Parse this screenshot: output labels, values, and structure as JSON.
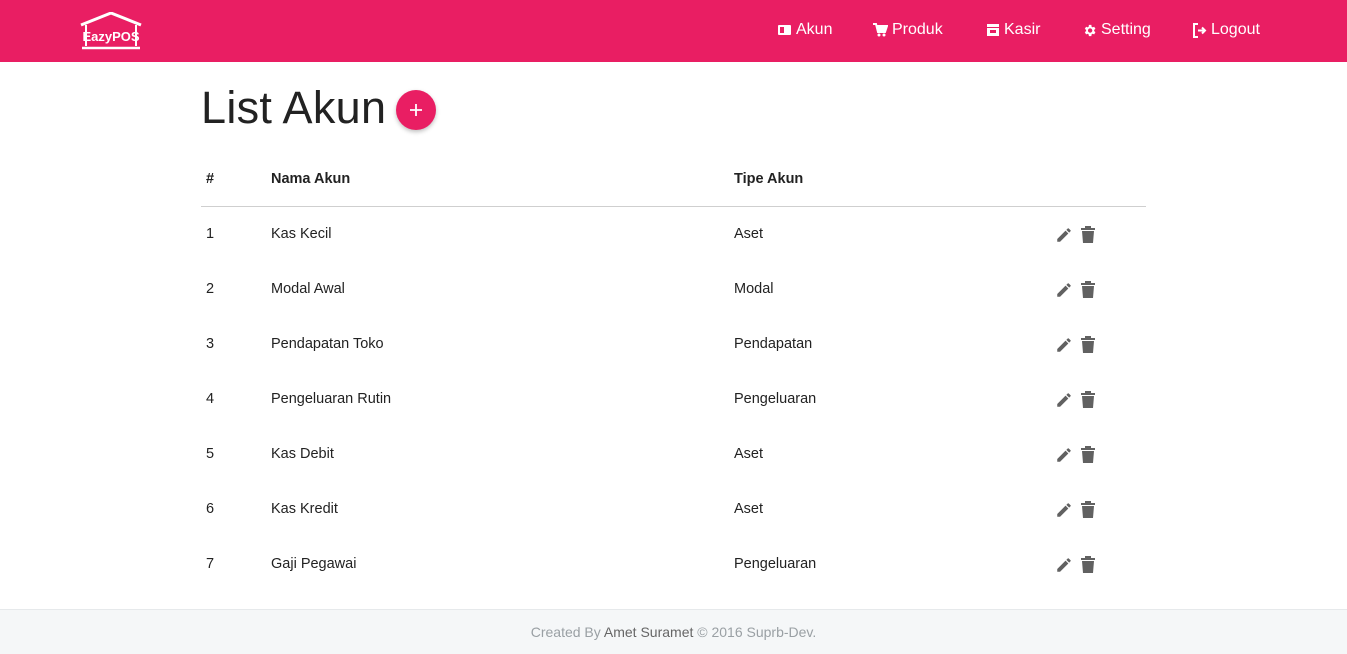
{
  "brand": {
    "logo_text": "EazyPOS",
    "color": "#e91e63"
  },
  "nav": {
    "items": [
      {
        "label": "Akun",
        "icon": "account-icon"
      },
      {
        "label": "Produk",
        "icon": "cart-icon"
      },
      {
        "label": "Kasir",
        "icon": "store-icon"
      },
      {
        "label": "Setting",
        "icon": "gear-icon"
      },
      {
        "label": "Logout",
        "icon": "logout-icon"
      }
    ]
  },
  "page": {
    "title": "List Akun",
    "add_button_icon": "plus-icon"
  },
  "table": {
    "headers": {
      "num": "#",
      "name": "Nama Akun",
      "type": "Tipe Akun"
    },
    "rows": [
      {
        "num": "1",
        "name": "Kas Kecil",
        "type": "Aset"
      },
      {
        "num": "2",
        "name": "Modal Awal",
        "type": "Modal"
      },
      {
        "num": "3",
        "name": "Pendapatan Toko",
        "type": "Pendapatan"
      },
      {
        "num": "4",
        "name": "Pengeluaran Rutin",
        "type": "Pengeluaran"
      },
      {
        "num": "5",
        "name": "Kas Debit",
        "type": "Aset"
      },
      {
        "num": "6",
        "name": "Kas Kredit",
        "type": "Aset"
      },
      {
        "num": "7",
        "name": "Gaji Pegawai",
        "type": "Pengeluaran"
      }
    ],
    "row_actions": [
      "edit-icon",
      "delete-icon"
    ]
  },
  "footer": {
    "prefix": "Created By",
    "author": "Amet Suramet",
    "suffix": "© 2016 Suprb-Dev."
  }
}
